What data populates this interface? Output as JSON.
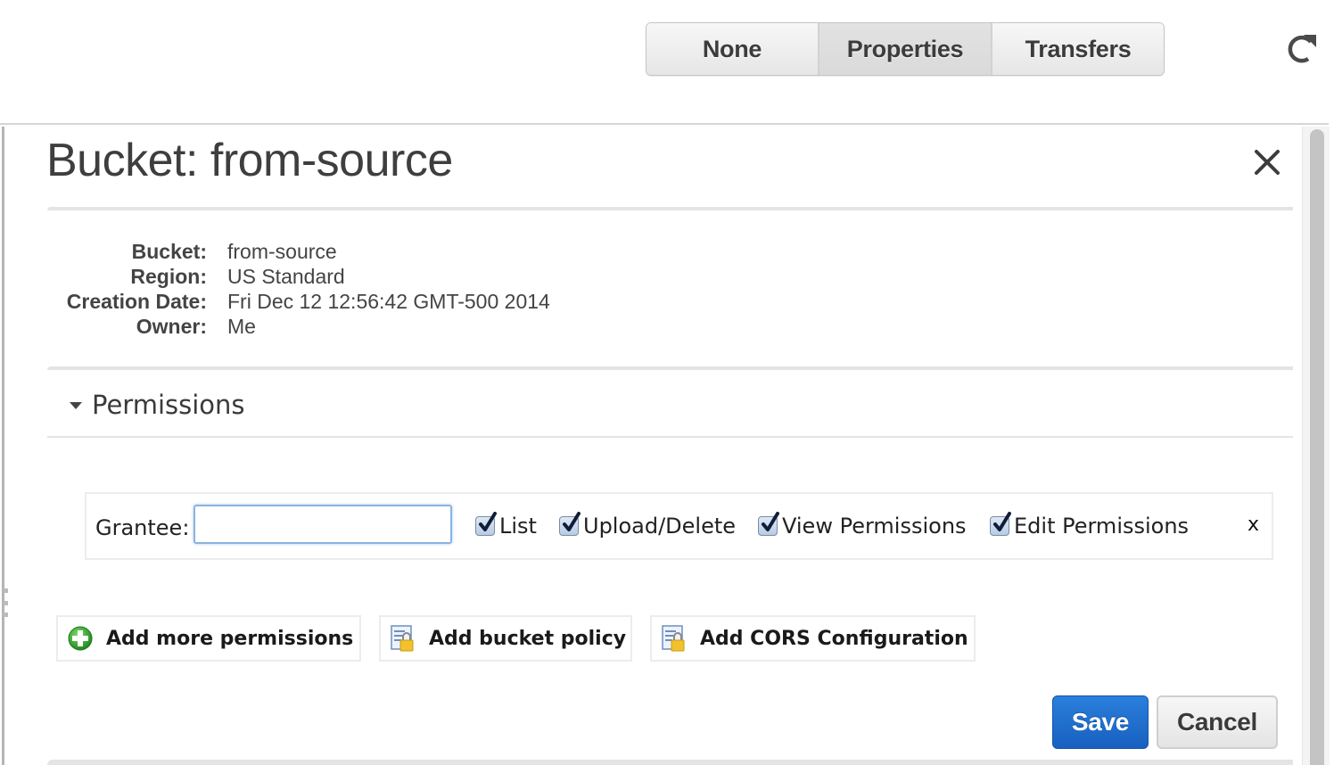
{
  "toolbar": {
    "view_buttons": [
      {
        "label": "None",
        "active": false
      },
      {
        "label": "Properties",
        "active": true
      },
      {
        "label": "Transfers",
        "active": false
      }
    ],
    "refresh_icon": "refresh-icon"
  },
  "panel": {
    "title": "Bucket: from-source",
    "close_icon": "close-icon",
    "details": [
      {
        "label": "Bucket:",
        "value": "from-source"
      },
      {
        "label": "Region:",
        "value": "US Standard"
      },
      {
        "label": "Creation Date:",
        "value": "Fri Dec 12 12:56:42 GMT-500 2014"
      },
      {
        "label": "Owner:",
        "value": "Me"
      }
    ]
  },
  "permissions": {
    "section_title": "Permissions",
    "expanded": true,
    "grantee": {
      "label": "Grantee:",
      "value": "",
      "placeholder": ""
    },
    "checkboxes": [
      {
        "label": "List",
        "checked": true
      },
      {
        "label": "Upload/Delete",
        "checked": true
      },
      {
        "label": "View Permissions",
        "checked": true
      },
      {
        "label": "Edit Permissions",
        "checked": true
      }
    ],
    "remove_label": "x",
    "actions": [
      {
        "label": "Add more permissions",
        "icon": "add-icon"
      },
      {
        "label": "Add bucket policy",
        "icon": "policy-lock-icon"
      },
      {
        "label": "Add CORS Configuration",
        "icon": "policy-lock-icon"
      }
    ]
  },
  "footer": {
    "save_label": "Save",
    "cancel_label": "Cancel"
  },
  "colors": {
    "primary": "#1a6dcc",
    "focus_border": "#8ab4e0",
    "add_icon_green": "#2ea02e"
  }
}
